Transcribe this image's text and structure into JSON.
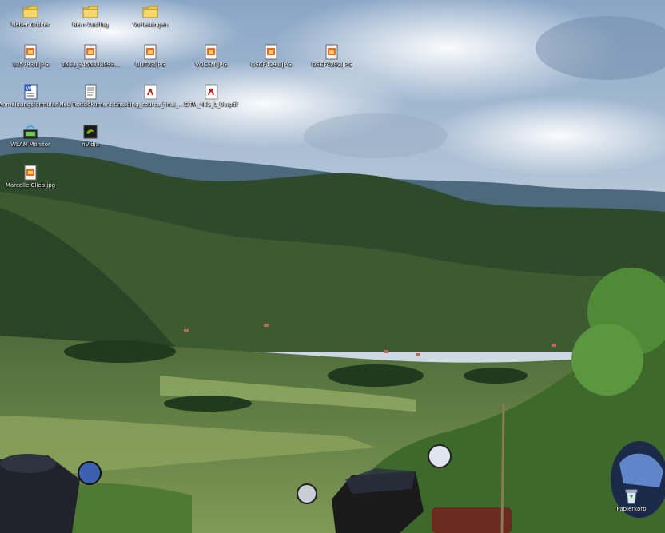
{
  "desktop": {
    "icons": [
      {
        "label": "Neuer Ordner",
        "icon": "folder-icon"
      },
      {
        "label": "Bern Ausflug",
        "icon": "folder-icon"
      },
      {
        "label": "Vorlesungen",
        "icon": "folder-icon"
      },
      {
        "label": "1257830.JPG",
        "icon": "jpg-file-icon"
      },
      {
        "label": "1653_3456338993...",
        "icon": "jpg-file-icon"
      },
      {
        "label": "OUT23.JPG",
        "icon": "jpg-file-icon"
      },
      {
        "label": "VOCSM.JPG",
        "icon": "jpg-file-icon"
      },
      {
        "label": "DSCF4291.JPG",
        "icon": "jpg-file-icon"
      },
      {
        "label": "DSCF4292.JPG",
        "icon": "jpg-file-icon"
      },
      {
        "label": "Anmeldungsformular...",
        "icon": "word-document-icon"
      },
      {
        "label": "Neu Textdokument.txt",
        "icon": "text-document-icon"
      },
      {
        "label": "reading_course_final_...",
        "icon": "pdf-document-icon"
      },
      {
        "label": "DTM_485_0_00.pdf",
        "icon": "pdf-document-icon"
      },
      {
        "label": "WLAN Monitor",
        "icon": "network-app-icon"
      },
      {
        "label": "nVidia",
        "icon": "nvidia-app-icon"
      },
      {
        "label": "Marcelle Clieb.jpg",
        "icon": "jpg-file-icon"
      },
      {
        "label": "Papierkorb",
        "icon": "recycle-bin-icon"
      }
    ],
    "wallpaper": "mountain valley landscape with motorcycles in foreground"
  }
}
